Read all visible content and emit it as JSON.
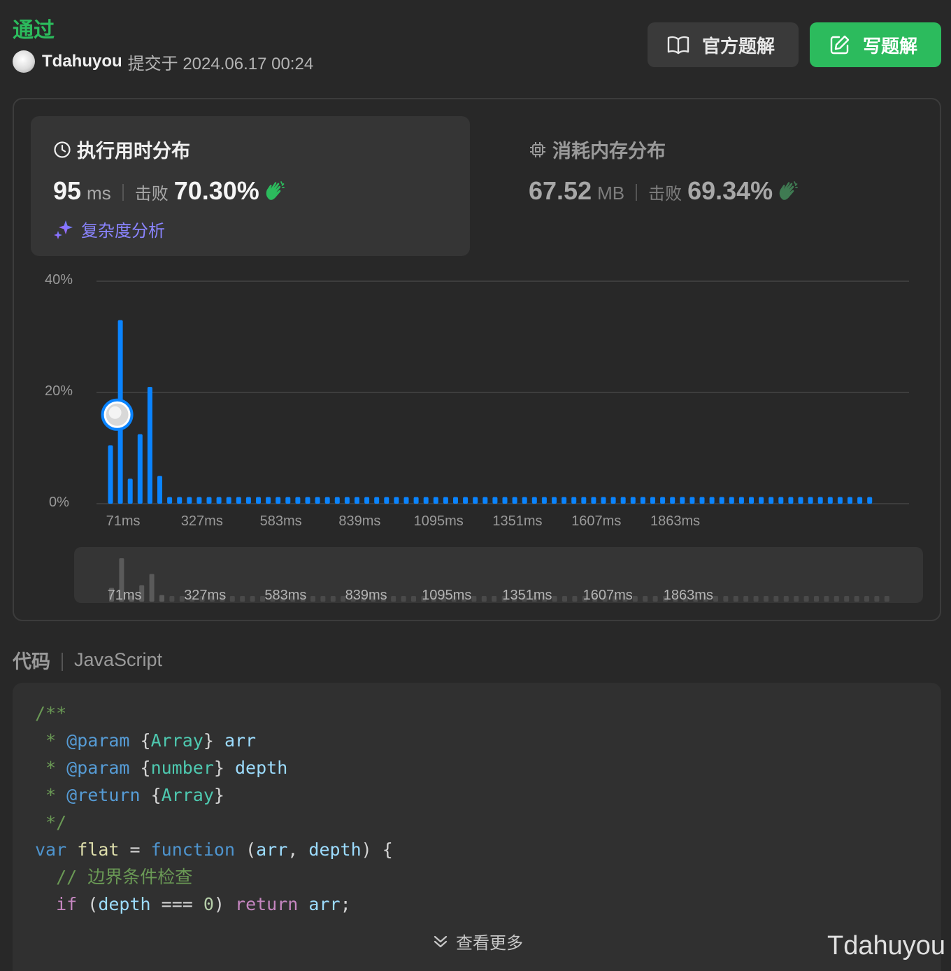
{
  "header": {
    "status": "通过",
    "username": "Tdahuyou",
    "submit_text": "提交于 2024.06.17 00:24"
  },
  "buttons": {
    "official_solution": "官方题解",
    "write_solution": "写题解"
  },
  "runtime": {
    "title": "执行用时分布",
    "value": "95",
    "unit": "ms",
    "beat_label": "击败",
    "beat_percent": "70.30%",
    "complexity_label": "复杂度分析"
  },
  "memory": {
    "title": "消耗内存分布",
    "value": "67.52",
    "unit": "MB",
    "beat_label": "击败",
    "beat_percent": "69.34%"
  },
  "chart_data": {
    "type": "bar",
    "y_ticks": [
      "40%",
      "20%",
      "0%"
    ],
    "ylim": [
      0,
      40
    ],
    "x_ticks": [
      "71ms",
      "327ms",
      "583ms",
      "839ms",
      "1095ms",
      "1351ms",
      "1607ms",
      "1863ms"
    ],
    "bar_width_ms": 32,
    "x_start_ms": 71,
    "values": [
      10.5,
      33,
      4.5,
      12.5,
      21,
      5,
      1.2,
      1.2,
      1.2,
      1.2,
      1.2,
      1.2,
      1.2,
      1.2,
      1.2,
      1.2,
      1.2,
      1.2,
      1.2,
      1.2,
      1.2,
      1.2,
      1.2,
      1.2,
      1.2,
      1.2,
      1.2,
      1.2,
      1.2,
      1.2,
      1.2,
      1.2,
      1.2,
      1.2,
      1.2,
      1.2,
      1.2,
      1.2,
      1.2,
      1.2,
      1.2,
      1.2,
      1.2,
      1.2,
      1.2,
      1.2,
      1.2,
      1.2,
      1.2,
      1.2,
      1.2,
      1.2,
      1.2,
      1.2,
      1.2,
      1.2,
      1.2,
      1.2,
      1.2,
      1.2,
      1.2,
      1.2,
      1.2,
      1.2,
      1.2,
      1.2,
      1.2,
      1.2,
      1.2,
      1.2,
      1.2,
      1.2,
      1.2,
      1.2,
      1.2,
      1.2,
      1.2,
      1.2
    ],
    "user_value_ms": 95,
    "user_percent": 16,
    "bar_color": "#0a84ff",
    "grid": true
  },
  "code_section": {
    "title": "代码",
    "language": "JavaScript",
    "view_more": "查看更多"
  },
  "code_lines": [
    [
      [
        "cm",
        "/**"
      ]
    ],
    [
      [
        "cm",
        " * "
      ],
      [
        "ctag",
        "@param"
      ],
      [
        "pn",
        " {"
      ],
      [
        "ty",
        "Array"
      ],
      [
        "pn",
        "} "
      ],
      [
        "vr",
        "arr"
      ]
    ],
    [
      [
        "cm",
        " * "
      ],
      [
        "ctag",
        "@param"
      ],
      [
        "pn",
        " {"
      ],
      [
        "ty",
        "number"
      ],
      [
        "pn",
        "} "
      ],
      [
        "vr",
        "depth"
      ]
    ],
    [
      [
        "cm",
        " * "
      ],
      [
        "ctag",
        "@return"
      ],
      [
        "pn",
        " {"
      ],
      [
        "ty",
        "Array"
      ],
      [
        "pn",
        "}"
      ]
    ],
    [
      [
        "cm",
        " */"
      ]
    ],
    [
      [
        "kw",
        "var"
      ],
      [
        "pn",
        " "
      ],
      [
        "fn",
        "flat"
      ],
      [
        "pn",
        " = "
      ],
      [
        "kw",
        "function"
      ],
      [
        "pn",
        " ("
      ],
      [
        "vr",
        "arr"
      ],
      [
        "pn",
        ", "
      ],
      [
        "vr",
        "depth"
      ],
      [
        "pn",
        ") {"
      ]
    ],
    [
      [
        "pn",
        "  "
      ],
      [
        "cm",
        "// 边界条件检查"
      ]
    ],
    [
      [
        "pn",
        "  "
      ],
      [
        "ctl",
        "if"
      ],
      [
        "pn",
        " ("
      ],
      [
        "vr",
        "depth"
      ],
      [
        "pn",
        " === "
      ],
      [
        "nm",
        "0"
      ],
      [
        "pn",
        ") "
      ],
      [
        "ctl",
        "return"
      ],
      [
        "pn",
        " "
      ],
      [
        "vr",
        "arr"
      ],
      [
        "pn",
        ";"
      ]
    ]
  ],
  "watermark": "Tdahuyou",
  "colors": {
    "accent_green": "#2cbb5d",
    "bar_blue": "#0a84ff",
    "complexity_purple": "#8a84ff"
  }
}
